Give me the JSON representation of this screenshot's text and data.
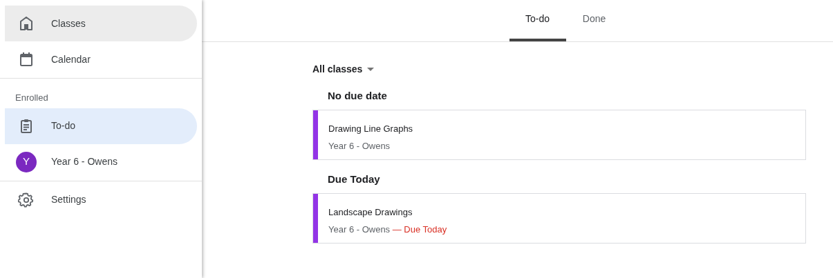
{
  "sidebar": {
    "groups": [
      {
        "items": [
          {
            "kind": "home",
            "label": "Classes",
            "selected": false,
            "hovered": true
          },
          {
            "kind": "calendar",
            "label": "Calendar",
            "selected": false,
            "hovered": false
          }
        ]
      },
      {
        "heading": "Enrolled",
        "items": [
          {
            "kind": "todo",
            "label": "To-do",
            "selected": true,
            "hovered": false
          },
          {
            "kind": "class",
            "avatar": "Y",
            "color": "#7b29c0",
            "label": "Year 6 - Owens",
            "selected": false,
            "hovered": false
          }
        ]
      },
      {
        "items": [
          {
            "kind": "settings",
            "label": "Settings",
            "selected": false,
            "hovered": false
          }
        ]
      }
    ]
  },
  "tabs": [
    {
      "label": "To-do",
      "selected": true
    },
    {
      "label": "Done",
      "selected": false
    }
  ],
  "filter": {
    "label": "All classes"
  },
  "sections": [
    {
      "heading": "No due date",
      "tasks": [
        {
          "title": "Drawing Line Graphs",
          "class_name": "Year 6 - Owens",
          "color": "#9334e6"
        }
      ]
    },
    {
      "heading": "Due Today",
      "tasks": [
        {
          "title": "Landscape Drawings",
          "class_name": "Year 6 - Owens",
          "due": "— Due Today",
          "color": "#9334e6"
        }
      ]
    }
  ]
}
